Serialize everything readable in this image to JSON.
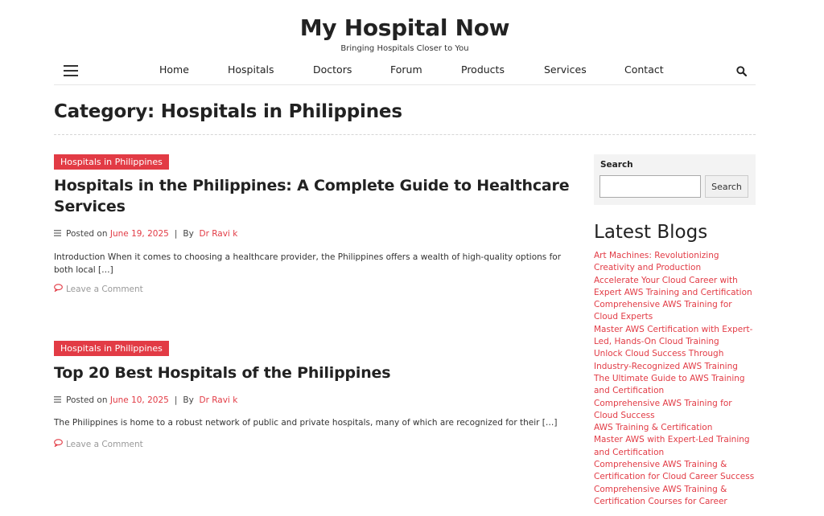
{
  "site": {
    "title": "My Hospital Now",
    "tagline": "Bringing Hospitals Closer to You"
  },
  "nav": {
    "items": [
      "Home",
      "Hospitals",
      "Doctors",
      "Forum",
      "Products",
      "Services",
      "Contact"
    ]
  },
  "category": {
    "heading": "Category: Hospitals in Philippines"
  },
  "posts": [
    {
      "category_badge": "Hospitals in Philippines",
      "title": "Hospitals in the Philippines: A Complete Guide to Healthcare Services",
      "posted_on_label": "Posted on",
      "date": "June 19, 2025",
      "separator": "|",
      "by_label": "By",
      "author": "Dr Ravi k",
      "excerpt": "Introduction When it comes to choosing a healthcare provider, the Philippines offers a wealth of high-quality options for both local […]",
      "comment_link": "Leave a Comment"
    },
    {
      "category_badge": "Hospitals in Philippines",
      "title": "Top 20 Best Hospitals of the Philippines",
      "posted_on_label": "Posted on",
      "date": "June 10, 2025",
      "separator": "|",
      "by_label": "By",
      "author": "Dr Ravi k",
      "excerpt": "The Philippines is home to a robust network of public and private hospitals, many of which are recognized for their […]",
      "comment_link": "Leave a Comment"
    }
  ],
  "sidebar": {
    "search": {
      "label": "Search",
      "placeholder": "",
      "button": "Search"
    },
    "latest_blogs": {
      "heading": "Latest Blogs",
      "items": [
        "Art Machines: Revolutionizing Creativity and Production",
        "Accelerate Your Cloud Career with Expert AWS Training and Certification",
        "Comprehensive AWS Training for Cloud Experts",
        "Master AWS Certification with Expert-Led, Hands-On Cloud Training",
        "Unlock Cloud Success Through Industry-Recognized AWS Training",
        "The Ultimate Guide to AWS Training and Certification",
        "Comprehensive AWS Training for Cloud Success",
        "AWS Training & Certification",
        "Master AWS with Expert-Led Training and Certification",
        "Comprehensive AWS Training & Certification for Cloud Career Success",
        "Comprehensive AWS Training & Certification Courses for Career"
      ]
    }
  },
  "icons": {
    "menu": "hamburger-menu-icon",
    "search": "search-icon",
    "meta": "list-icon",
    "comment": "comment-bubble-icon"
  },
  "colors": {
    "accent": "#e23b45",
    "text": "#222222",
    "muted": "#999999",
    "widget_bg": "#f3f3f3"
  }
}
